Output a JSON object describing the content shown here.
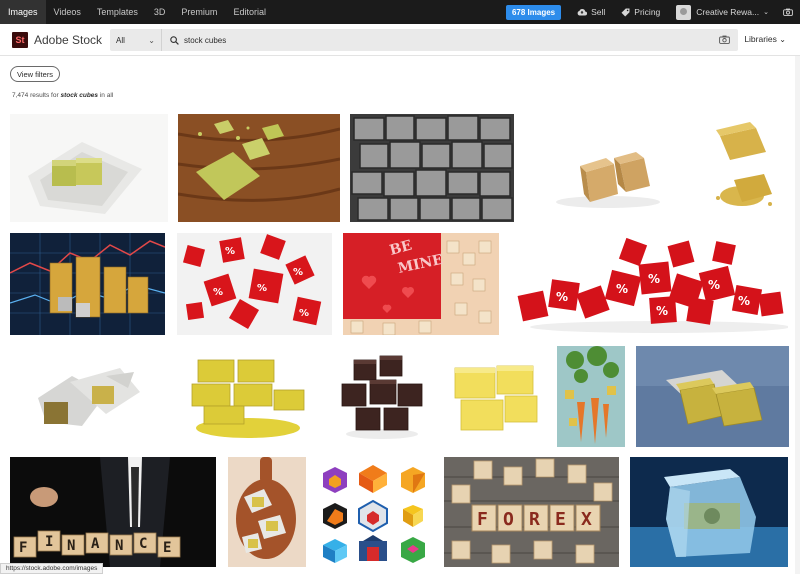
{
  "nav": {
    "tabs": [
      "Images",
      "Videos",
      "Templates",
      "3D",
      "Premium",
      "Editorial"
    ],
    "active_tab": "Images",
    "images_button": "678 Images",
    "sell": "Sell",
    "pricing": "Pricing",
    "account": "Creative Rewa..."
  },
  "brand": {
    "badge": "St",
    "name": "Adobe Stock"
  },
  "search": {
    "category": "All",
    "query": "stock cubes"
  },
  "libraries": "Libraries",
  "filters": {
    "view_filters": "View filters",
    "result_count": "7,474",
    "results_label": "results for",
    "query": "stock cubes",
    "scope": "in all"
  },
  "status_url": "https://stock.adobe.com/images",
  "thumbnails": [
    {
      "name": "stock-cubes-in-foil"
    },
    {
      "name": "stock-cubes-on-wooden-board"
    },
    {
      "name": "stone-cubes-gabion"
    },
    {
      "name": "two-bouillon-cubes"
    },
    {
      "name": "bouillon-cube-and-crumbs"
    },
    {
      "name": "coins-on-stock-chart"
    },
    {
      "name": "red-percent-dice-flying"
    },
    {
      "name": "be-mine-letter-cubes"
    },
    {
      "name": "red-percent-cubes-pile"
    },
    {
      "name": "stock-cubes-in-wrappers"
    },
    {
      "name": "yellow-stock-cubes-stack"
    },
    {
      "name": "brown-stock-cubes"
    },
    {
      "name": "yellow-stock-cubes"
    },
    {
      "name": "vegetables-and-stock-cubes"
    },
    {
      "name": "stock-cubes-on-blue"
    },
    {
      "name": "finance-letter-blocks"
    },
    {
      "name": "stock-cubes-on-cutting-board"
    },
    {
      "name": "isometric-cube-logos"
    },
    {
      "name": "forex-wooden-cubes"
    },
    {
      "name": "dollar-in-ice-cube"
    }
  ]
}
